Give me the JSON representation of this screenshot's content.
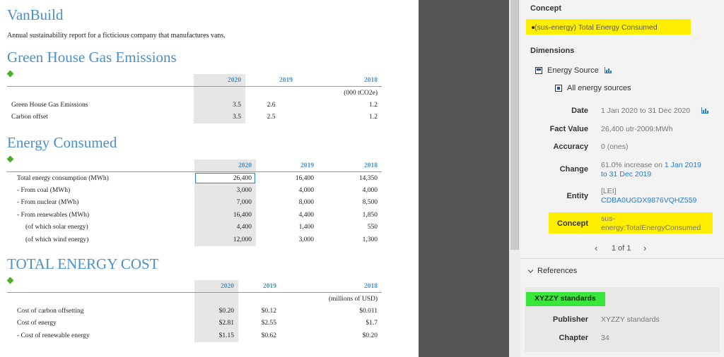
{
  "doc": {
    "brand": "VanBuild",
    "subtitle": "Annual sustainability report for a ficticious company that manufactures vans.",
    "ghg": {
      "title": "Green House Gas Emissions",
      "years": [
        "2020",
        "2019",
        "2018"
      ],
      "unit": "(000 tCO2e)",
      "rows": [
        {
          "label": "Green House Gas Emissions",
          "v2020": "3.5",
          "v2019": "2.6",
          "v2018": "1.2"
        },
        {
          "label": "Carbon offset",
          "v2020": "3.5",
          "v2019": "2.5",
          "v2018": "1.2"
        }
      ]
    },
    "energy": {
      "title": "Energy Consumed",
      "years": [
        "2020",
        "2019",
        "2018"
      ],
      "rows": [
        {
          "label": "Total energy consumption (MWh)",
          "v2020": "26,400",
          "v2019": "16,400",
          "v2018": "14,350"
        },
        {
          "label": "- From coal (MWh)",
          "v2020": "3,000",
          "v2019": "4,000",
          "v2018": "4,000"
        },
        {
          "label": "- From nuclear (MWh)",
          "v2020": "7,000",
          "v2019": "8,000",
          "v2018": "8,500"
        },
        {
          "label": "- From renewables (MWh)",
          "v2020": "16,400",
          "v2019": "4,400",
          "v2018": "1,850"
        },
        {
          "label": "(of which solar energy)",
          "v2020": "4,400",
          "v2019": "1,400",
          "v2018": "550"
        },
        {
          "label": "(of which wind energy)",
          "v2020": "12,000",
          "v2019": "3,000",
          "v2018": "1,300"
        }
      ]
    },
    "cost": {
      "title": "TOTAL ENERGY COST",
      "years": [
        "2020",
        "2019",
        "2018"
      ],
      "unit": "(millions of USD)",
      "rows": [
        {
          "label": "Cost of carbon offsetting",
          "v2020": "$0.20",
          "v2019": "$0.12",
          "v2018": "$0.011"
        },
        {
          "label": "Cost of energy",
          "v2020": "$2.81",
          "v2019": "$2.55",
          "v2018": "$1.7"
        },
        {
          "label": "- Cost of renewable energy",
          "v2020": "$1.15",
          "v2019": "$0.62",
          "v2018": "$0.20"
        }
      ]
    }
  },
  "panel": {
    "concept_heading": "Concept",
    "concept_value": "(sus-energy) Total Energy Consumed",
    "dimensions_heading": "Dimensions",
    "dimension_name": "Energy Source",
    "dimension_member": "All energy sources",
    "fields": {
      "date_label": "Date",
      "date_value": "1 Jan 2020 to 31 Dec 2020",
      "fact_label": "Fact Value",
      "fact_value": "26,400 utr-2009:MWh",
      "accuracy_label": "Accuracy",
      "accuracy_value": "0 (ones)",
      "change_label": "Change",
      "change_prefix": "61.0% increase on ",
      "change_link": "1 Jan 2019",
      "change_link2": "to 31 Dec 2019",
      "entity_label": "Entity",
      "entity_scheme": "[LEI]",
      "entity_value": "CDBA0UGDX9876VQHZ559",
      "concept_label": "Concept",
      "concept_line1": "sus-",
      "concept_line2": "energy:TotalEnergyConsumed"
    },
    "pager": {
      "prev": "‹",
      "text": "1 of 1",
      "next": "›"
    },
    "references_heading": "References",
    "reference": {
      "title": "XYZZY standards",
      "publisher_label": "Publisher",
      "publisher_value": "XYZZY standards",
      "chapter_label": "Chapter",
      "chapter_value": "34"
    },
    "colors": {
      "highlight": "#ffee00",
      "green_highlight": "#39e639",
      "link": "#2a7bc8",
      "heading_blue": "#4a90c8",
      "diamond": "#4caf2a"
    }
  }
}
